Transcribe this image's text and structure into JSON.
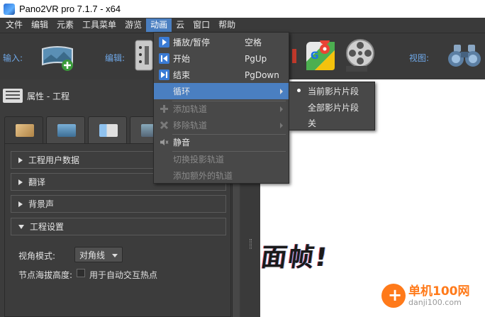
{
  "window": {
    "title": "Pano2VR pro 7.1.7 - x64"
  },
  "menubar": {
    "items": [
      "文件",
      "编辑",
      "元素",
      "工具菜单",
      "游览",
      "动画",
      "云",
      "窗口",
      "帮助"
    ],
    "active": "动画"
  },
  "toolbar": {
    "input_label": "输入:",
    "edit_label": "编辑:",
    "view_label": "视图:"
  },
  "panel": {
    "title": "属性 - 工程"
  },
  "sections": [
    {
      "label": "工程用户数据",
      "expanded": false
    },
    {
      "label": "翻译",
      "expanded": false
    },
    {
      "label": "背景声",
      "expanded": false
    },
    {
      "label": "工程设置",
      "expanded": true
    }
  ],
  "settings": {
    "view_mode_label": "视角模式:",
    "view_mode_value": "对角线",
    "node_height_label": "节点海拔高度:",
    "auto_hotspot_label": "用于自动交互热点"
  },
  "anim_menu": {
    "play_pause": {
      "label": "播放/暂停",
      "shortcut": "空格"
    },
    "start": {
      "label": "开始",
      "shortcut": "PgUp"
    },
    "end": {
      "label": "结束",
      "shortcut": "PgDown"
    },
    "loop": {
      "label": "循环"
    },
    "add_track": {
      "label": "添加轨道"
    },
    "remove_track": {
      "label": "移除轨道"
    },
    "mute": {
      "label": "静音"
    },
    "toggle_projection_track": {
      "label": "切换投影轨道"
    },
    "add_extra_track": {
      "label": "添加额外的轨道"
    }
  },
  "loop_submenu": {
    "items": [
      "当前影片片段",
      "全部影片片段",
      "关"
    ],
    "selected": "当前影片片段"
  },
  "canvas": {
    "text": "面帧!"
  },
  "watermark": {
    "line1": "单机100网",
    "line2": "danji100.com"
  },
  "colors": {
    "accent": "#4a7fc1",
    "menu_bg": "#484848",
    "toolbar_label": "#6fa8e8",
    "watermark": "#ff7a1a"
  }
}
